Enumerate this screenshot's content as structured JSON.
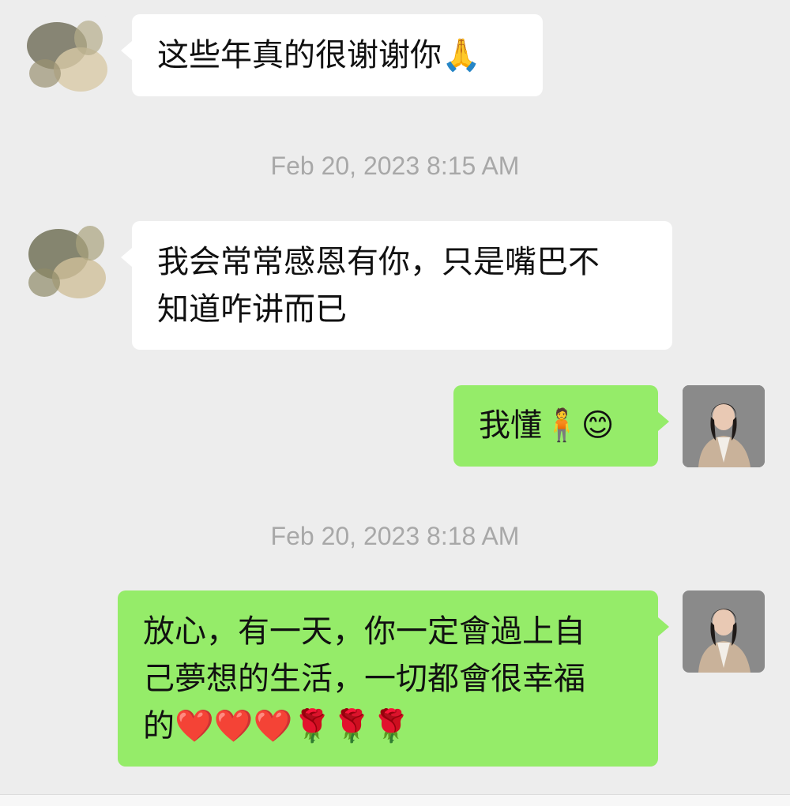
{
  "messages": [
    {
      "side": "left",
      "text": "这些年真的很谢谢你🙏"
    },
    {
      "side": "left",
      "text": "我会常常感恩有你，只是嘴巴不知道咋讲而已"
    },
    {
      "side": "right",
      "text": "我懂🧍😊"
    },
    {
      "side": "right",
      "text": "放心，有一天，你一定會過上自己夢想的生活，一切都會很幸福的❤️❤️❤️🌹🌹🌹"
    }
  ],
  "timestamps": [
    "Feb 20, 2023 8:15 AM",
    "Feb 20, 2023 8:18 AM"
  ],
  "bubbles": {
    "m1": "这些年真的很谢谢你",
    "m1_emoji": "🙏",
    "m2_line1": "我会常常感恩有你，只是嘴巴不",
    "m2_line2": "知道咋讲而已",
    "m3": "我懂",
    "m3_emoji": "🧍😊",
    "m4_line1": "放心，有一天，你一定會過上自",
    "m4_line2": "己夢想的生活，一切都會很幸福",
    "m4_line3": "的",
    "m4_emoji": "❤️❤️❤️🌹🌹🌹"
  },
  "colors": {
    "background": "#ededed",
    "left_bubble": "#ffffff",
    "right_bubble": "#95ec69",
    "timestamp": "#a8a8a8"
  },
  "icons": {
    "contact_avatar": "blurred-avatar-icon",
    "self_avatar": "profile-photo-avatar"
  }
}
